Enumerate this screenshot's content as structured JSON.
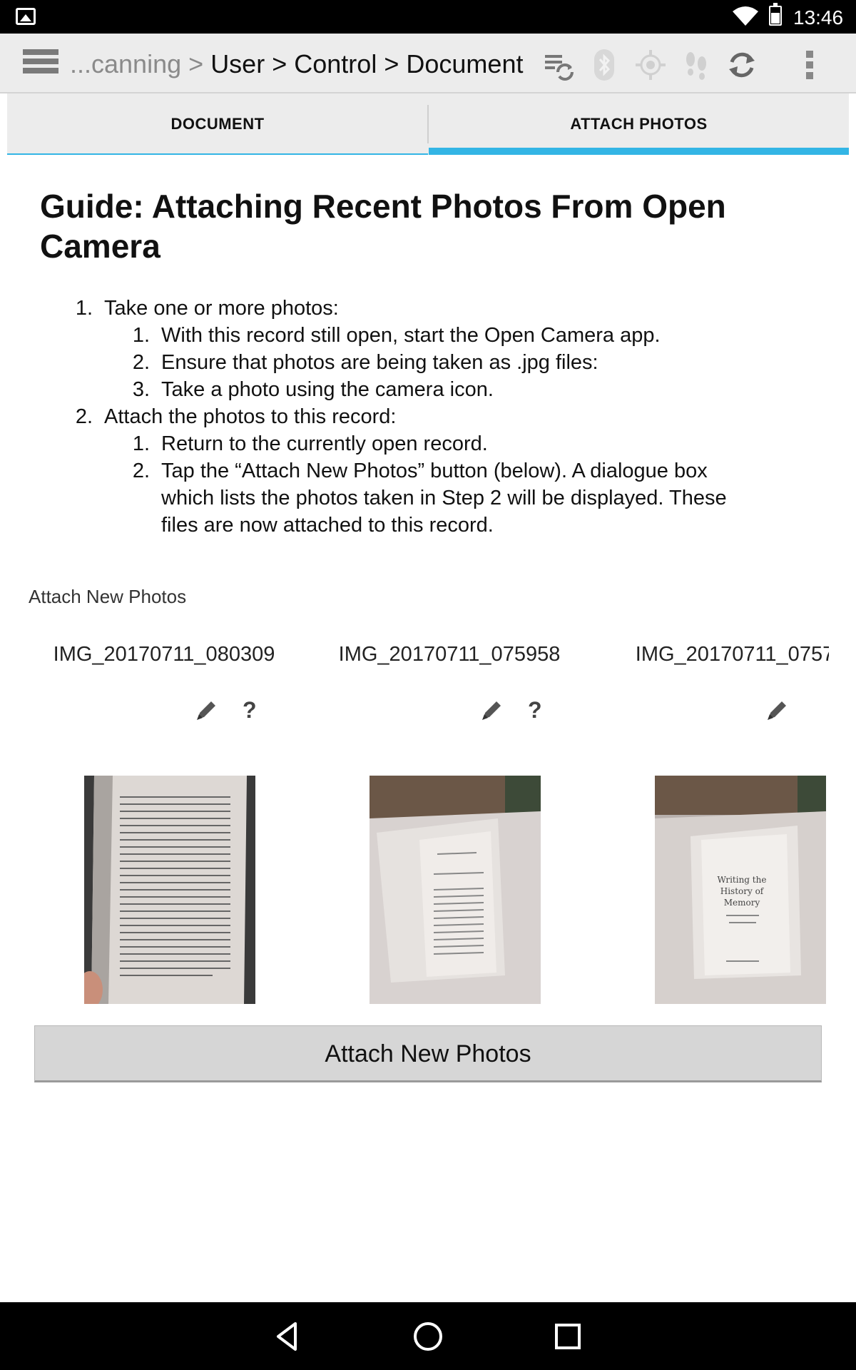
{
  "status_bar": {
    "time": "13:46",
    "icons": [
      "picture-icon",
      "wifi-icon",
      "battery-icon"
    ]
  },
  "action_bar": {
    "breadcrumb": {
      "prefix": "...canning",
      "separator": ">",
      "items": [
        "User",
        "Control",
        "Document"
      ]
    },
    "icons": [
      "menu-icon",
      "sync-list-icon",
      "bluetooth-icon",
      "gps-icon",
      "footsteps-icon",
      "refresh-icon",
      "overflow-menu-icon"
    ]
  },
  "tabs": [
    {
      "label": "DOCUMENT",
      "selected": false
    },
    {
      "label": "ATTACH PHOTOS",
      "selected": true
    }
  ],
  "guide": {
    "title": "Guide: Attaching Recent Photos From Open Camera",
    "steps": [
      {
        "num": "1.",
        "text": "Take one or more photos:",
        "substeps": [
          {
            "num": "1.",
            "text": "With this record still open, start the Open Camera app."
          },
          {
            "num": "2.",
            "text": "Ensure that photos are being taken as .jpg files:"
          },
          {
            "num": "3.",
            "text": "Take a photo using the camera icon."
          }
        ]
      },
      {
        "num": "2.",
        "text": "Attach the photos to this record:",
        "substeps": [
          {
            "num": "1.",
            "text": "Return to the currently open record."
          },
          {
            "num": "2.",
            "text_lines": [
              "Tap the “Attach New Photos” button (below). A dialogue box",
              "which lists the photos taken in Step 2 will be displayed. These",
              "files are now attached to this record."
            ]
          }
        ]
      }
    ]
  },
  "attach_section": {
    "label": "Attach New Photos",
    "photos": [
      {
        "name": "IMG_20170711_080309",
        "has_help": true
      },
      {
        "name": "IMG_20170711_075958",
        "has_help": true
      },
      {
        "name": "IMG_20170711_0757",
        "has_help": false
      }
    ],
    "help_symbol": "?",
    "button_label": "Attach New Photos",
    "thumb_text": [
      "Writing the",
      "History of",
      "Memory"
    ]
  },
  "nav_bar": {
    "icons": [
      "back-icon",
      "home-icon",
      "recents-icon"
    ]
  },
  "colors": {
    "accent": "#33b5e5",
    "bar_bg": "#ececec",
    "button_bg": "#d6d6d6"
  }
}
